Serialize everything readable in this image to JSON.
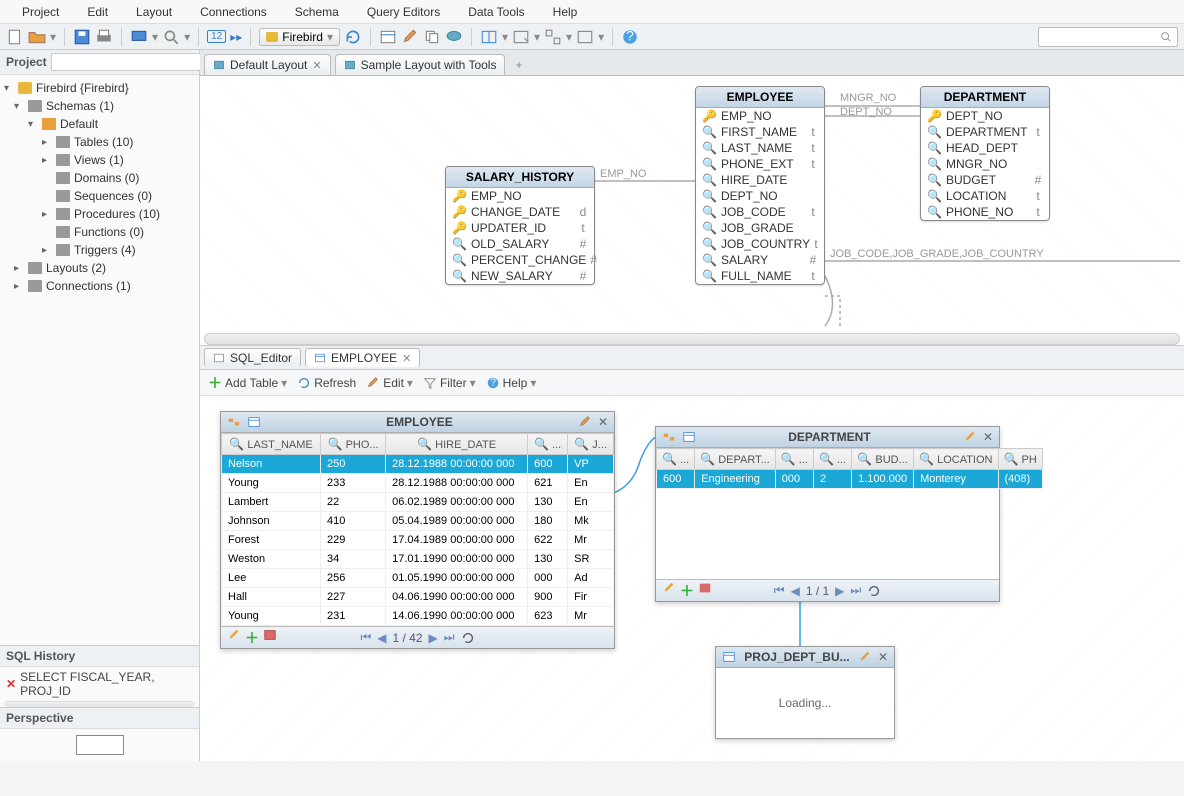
{
  "menubar": [
    "Project",
    "Edit",
    "Layout",
    "Connections",
    "Schema",
    "Query Editors",
    "Data Tools",
    "Help"
  ],
  "toolbar": {
    "combo": "Firebird"
  },
  "project_panel": {
    "title": "Project"
  },
  "tree": {
    "root": "Firebird {Firebird}",
    "schemas": "Schemas (1)",
    "default": "Default",
    "tables": "Tables (10)",
    "views": "Views (1)",
    "domains": "Domains (0)",
    "sequences": "Sequences (0)",
    "procedures": "Procedures (10)",
    "functions": "Functions (0)",
    "triggers": "Triggers (4)",
    "layouts": "Layouts (2)",
    "connections": "Connections (1)"
  },
  "sql_history": {
    "title": "SQL History",
    "row": "SELECT FISCAL_YEAR, PROJ_ID"
  },
  "perspective": {
    "title": "Perspective"
  },
  "tabs": {
    "t1": "Default Layout",
    "t2": "Sample Layout with Tools"
  },
  "erd": {
    "salary_history": {
      "title": "SALARY_HISTORY",
      "cols": [
        "EMP_NO",
        "CHANGE_DATE",
        "UPDATER_ID",
        "OLD_SALARY",
        "PERCENT_CHANGE",
        "NEW_SALARY"
      ],
      "types": [
        "",
        "d",
        "t",
        "#",
        "#",
        "#"
      ]
    },
    "employee": {
      "title": "EMPLOYEE",
      "cols": [
        "EMP_NO",
        "FIRST_NAME",
        "LAST_NAME",
        "PHONE_EXT",
        "HIRE_DATE",
        "DEPT_NO",
        "JOB_CODE",
        "JOB_GRADE",
        "JOB_COUNTRY",
        "SALARY",
        "FULL_NAME"
      ],
      "types": [
        "",
        "t",
        "t",
        "t",
        "",
        "",
        "t",
        "",
        "t",
        "#",
        "t"
      ]
    },
    "department": {
      "title": "DEPARTMENT",
      "cols": [
        "DEPT_NO",
        "DEPARTMENT",
        "HEAD_DEPT",
        "MNGR_NO",
        "BUDGET",
        "LOCATION",
        "PHONE_NO"
      ],
      "types": [
        "",
        "t",
        "",
        "",
        "#",
        "t",
        "t"
      ]
    },
    "link1": "EMP_NO",
    "link2": "MNGR_NO",
    "link3": "DEPT_NO",
    "link4": "JOB_CODE,JOB_GRADE,JOB_COUNTRY"
  },
  "subtabs": {
    "sql": "SQL_Editor",
    "emp": "EMPLOYEE"
  },
  "actions": {
    "add": "Add Table",
    "refresh": "Refresh",
    "edit": "Edit",
    "filter": "Filter",
    "help": "Help"
  },
  "emp_win": {
    "title": "EMPLOYEE",
    "cols": [
      "LAST_NAME",
      "PHO...",
      "HIRE_DATE",
      "...",
      "J..."
    ],
    "rows": [
      [
        "Nelson",
        "250",
        "28.12.1988 00:00:00 000",
        "600",
        "VP"
      ],
      [
        "Young",
        "233",
        "28.12.1988 00:00:00 000",
        "621",
        "En"
      ],
      [
        "Lambert",
        "22",
        "06.02.1989 00:00:00 000",
        "130",
        "En"
      ],
      [
        "Johnson",
        "410",
        "05.04.1989 00:00:00 000",
        "180",
        "Mk"
      ],
      [
        "Forest",
        "229",
        "17.04.1989 00:00:00 000",
        "622",
        "Mr"
      ],
      [
        "Weston",
        "34",
        "17.01.1990 00:00:00 000",
        "130",
        "SR"
      ],
      [
        "Lee",
        "256",
        "01.05.1990 00:00:00 000",
        "000",
        "Ad"
      ],
      [
        "Hall",
        "227",
        "04.06.1990 00:00:00 000",
        "900",
        "Fir"
      ],
      [
        "Young",
        "231",
        "14.06.1990 00:00:00 000",
        "623",
        "Mr"
      ]
    ],
    "pager": "1 / 42"
  },
  "dept_win": {
    "title": "DEPARTMENT",
    "cols": [
      "...",
      "DEPART...",
      "...",
      "...",
      "BUD...",
      "LOCATION",
      "PH"
    ],
    "rows": [
      [
        "600",
        "Engineering",
        "000",
        "2",
        "1.100.000",
        "Monterey",
        "(408)"
      ]
    ],
    "pager": "1 / 1"
  },
  "proj_win": {
    "title": "PROJ_DEPT_BU...",
    "loading": "Loading..."
  }
}
